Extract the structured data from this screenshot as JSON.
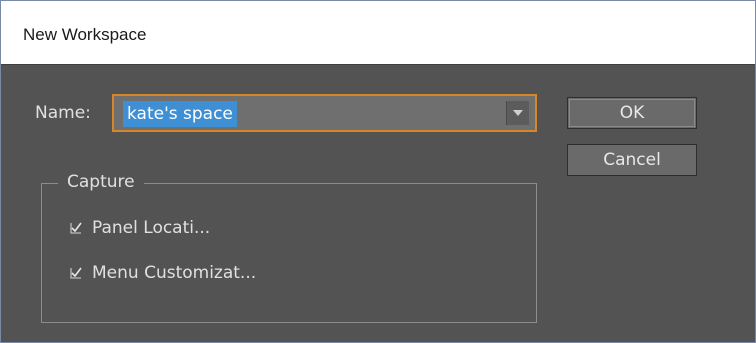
{
  "window": {
    "title": "New Workspace"
  },
  "form": {
    "name_label": "Name:",
    "name_value": "kate's space"
  },
  "buttons": {
    "ok_label": "OK",
    "cancel_label": "Cancel"
  },
  "capture": {
    "legend": "Capture",
    "options": [
      {
        "label": "Panel Locati...",
        "checked": true
      },
      {
        "label": "Menu Customizat...",
        "checked": true
      }
    ]
  },
  "colors": {
    "dialog_bg": "#535353",
    "focus_border": "#d8862a",
    "selection": "#3f8fd4"
  },
  "icons": {
    "combo_arrow": "chevron-down-icon",
    "check": "checkmark-icon"
  }
}
